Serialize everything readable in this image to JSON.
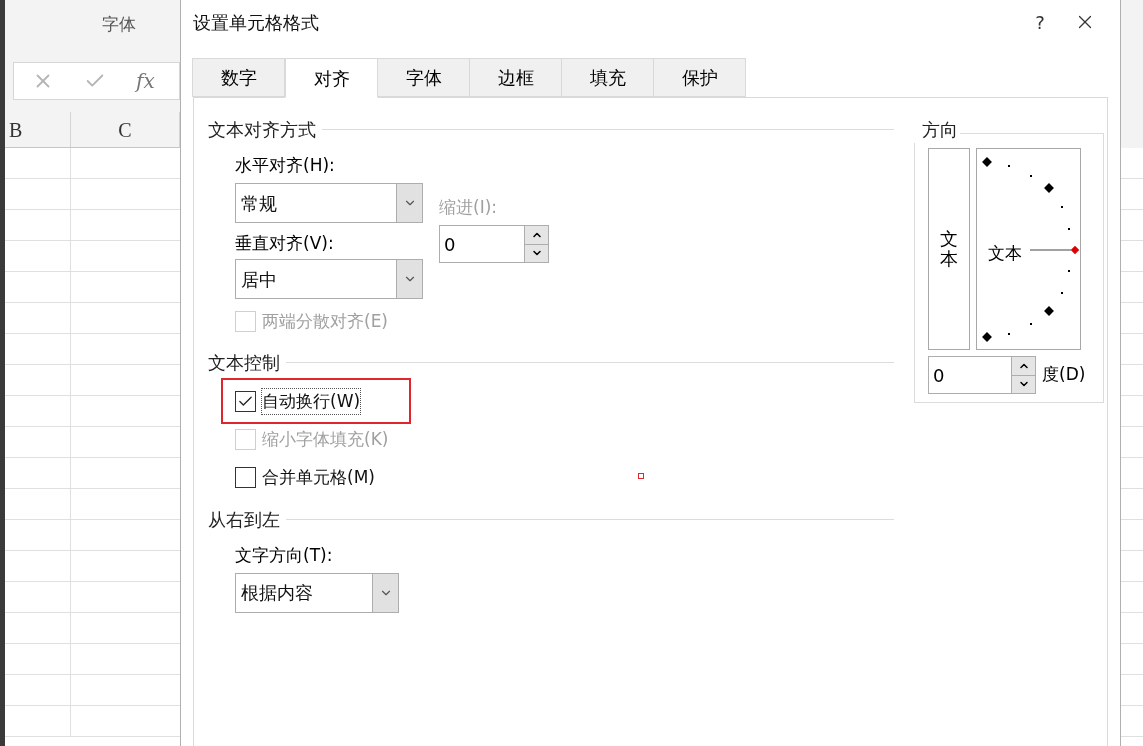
{
  "sheet": {
    "ribbon_group": "字体",
    "fx": "fx",
    "columns": [
      "B",
      "C"
    ]
  },
  "dialog": {
    "title": "设置单元格格式",
    "help": "?"
  },
  "tabs": [
    {
      "label": "数字",
      "selected": false
    },
    {
      "label": "对齐",
      "selected": true
    },
    {
      "label": "字体",
      "selected": false
    },
    {
      "label": "边框",
      "selected": false
    },
    {
      "label": "填充",
      "selected": false
    },
    {
      "label": "保护",
      "selected": false
    }
  ],
  "alignment": {
    "title": "文本对齐方式",
    "horizontal_label": "水平对齐(H):",
    "horizontal_value": "常规",
    "vertical_label": "垂直对齐(V):",
    "vertical_value": "居中",
    "indent_label": "缩进(I):",
    "indent_disabled": true,
    "indent_value": "0",
    "distributed": {
      "label": "两端分散对齐(E)",
      "checked": false,
      "disabled": true
    }
  },
  "text_control": {
    "title": "文本控制",
    "options": [
      {
        "label": "自动换行(W)",
        "checked": true,
        "disabled": false,
        "highlighted": true
      },
      {
        "label": "缩小字体填充(K)",
        "checked": false,
        "disabled": true,
        "highlighted": false
      },
      {
        "label": "合并单元格(M)",
        "checked": false,
        "disabled": false,
        "highlighted": false
      }
    ]
  },
  "right_to_left": {
    "title": "从右到左",
    "direction_label": "文字方向(T):",
    "direction_value": "根据内容"
  },
  "orientation": {
    "title": "方向",
    "vertical_text": "文本",
    "dial_text": "文本",
    "degrees_value": "0",
    "degrees_label": "度(D)"
  }
}
